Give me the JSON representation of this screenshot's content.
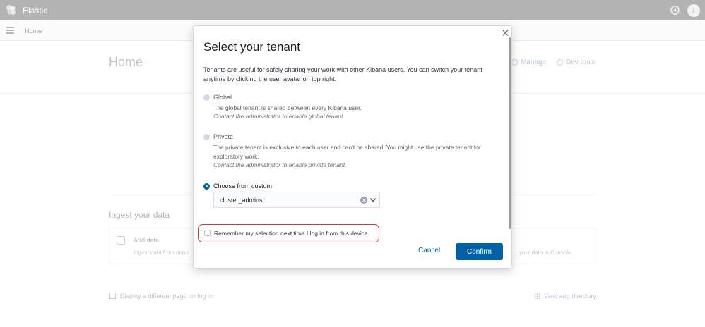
{
  "app": {
    "brand": "Elastic",
    "avatar_initial": "i"
  },
  "subbar": {
    "breadcrumb": "Home"
  },
  "page": {
    "title": "Home",
    "links": {
      "manage": "Manage",
      "dev_tools": "Dev tools"
    },
    "ingest": {
      "title": "Ingest your data",
      "card_title": "Add data",
      "card_desc": "Ingest data from popu",
      "card_right": "your data in Console."
    },
    "footer": {
      "left": "Display a different page on log in",
      "right": "View app directory"
    }
  },
  "modal": {
    "title": "Select your tenant",
    "intro": "Tenants are useful for safely sharing your work with other Kibana users. You can switch your tenant anytime by clicking the user avatar on top right.",
    "options": [
      {
        "label": "Global",
        "desc": "The global tenant is shared between every Kibana user.",
        "note": "Contact the administrator to enable global tenant.",
        "state": "disabled"
      },
      {
        "label": "Private",
        "desc": "The private tenant is exclusive to each user and can't be shared. You might use the private tenant for exploratory work.",
        "note": "Contact the administrator to enable private tenant.",
        "state": "disabled"
      },
      {
        "label": "Choose from custom",
        "state": "checked"
      }
    ],
    "select": {
      "value": "cluster_admins"
    },
    "remember_label": "Remember my selection next time I log in from this device.",
    "cancel_label": "Cancel",
    "confirm_label": "Confirm"
  },
  "colors": {
    "primary": "#0061a6",
    "highlight": "#d63333",
    "header": "#b3b3b3"
  }
}
